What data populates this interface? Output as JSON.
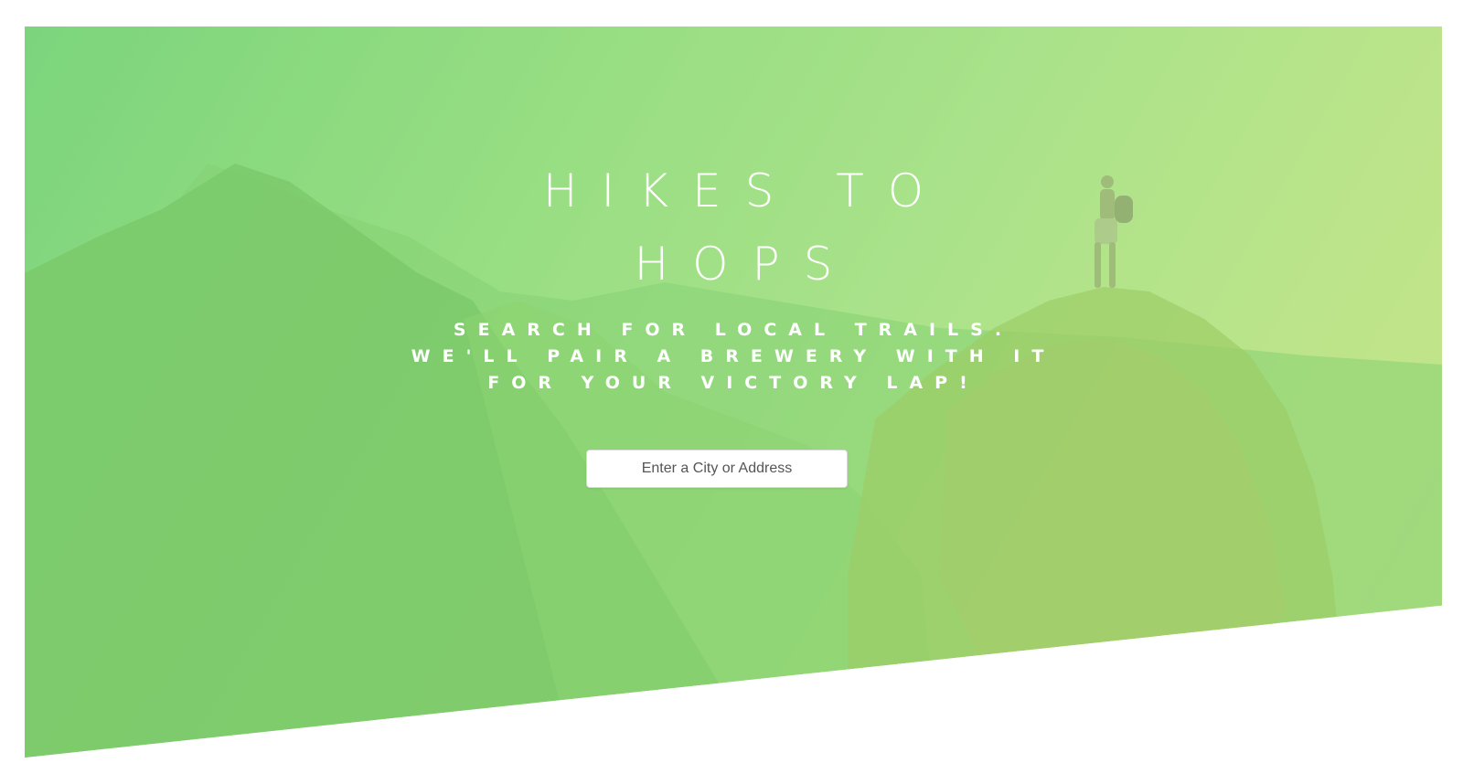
{
  "hero": {
    "title_line1": "HIKES TO",
    "title_line2": "HOPS",
    "tagline": "SEARCH FOR LOCAL TRAILS. WE'LL PAIR A BREWERY WITH IT FOR YOUR VICTORY LAP!"
  },
  "search": {
    "value": "",
    "placeholder": "Enter a City or Address"
  },
  "colors": {
    "gradient_start": "#6fd27a",
    "gradient_end": "#c9e288",
    "text": "#ffffff"
  }
}
